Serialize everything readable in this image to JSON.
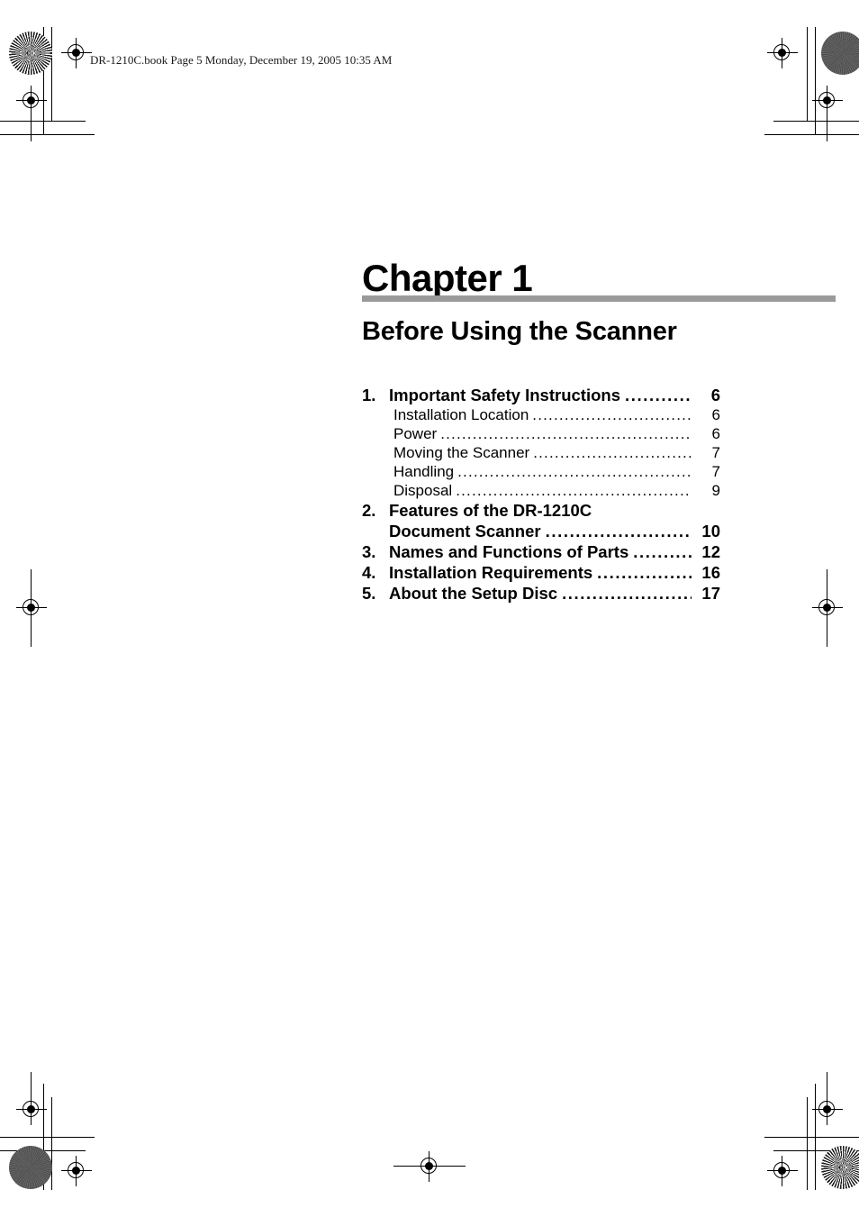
{
  "page": {
    "running_header": "DR-1210C.book  Page 5  Monday, December 19, 2005  10:35 AM",
    "chapter_label": "Chapter 1",
    "chapter_title": "Before Using the Scanner",
    "rule_color": "#9a9a9a"
  },
  "toc": {
    "entries": [
      {
        "level": "major",
        "number": "1.",
        "label": "Important Safety Instructions",
        "leader": "..............",
        "page": "6"
      },
      {
        "level": "minor",
        "number": "",
        "label": "Installation Location",
        "leader": "....................................",
        "page": "6"
      },
      {
        "level": "minor",
        "number": "",
        "label": "Power",
        "leader": "..........................................................",
        "page": "6"
      },
      {
        "level": "minor",
        "number": "",
        "label": "Moving the Scanner",
        "leader": "...................................",
        "page": "7"
      },
      {
        "level": "minor",
        "number": "",
        "label": "Handling",
        "leader": ".....................................................",
        "page": "7"
      },
      {
        "level": "minor",
        "number": "",
        "label": "Disposal",
        "leader": "......................................................",
        "page": "9"
      },
      {
        "level": "major",
        "number": "2.",
        "label": "Features of the DR-1210C",
        "leader": "",
        "page": ""
      },
      {
        "level": "major-cont",
        "number": "",
        "label": "Document Scanner",
        "leader": "............................",
        "page": "10"
      },
      {
        "level": "major",
        "number": "3.",
        "label": "Names and Functions of Parts",
        "leader": "..........",
        "page": "12"
      },
      {
        "level": "major",
        "number": "4.",
        "label": "Installation Requirements",
        "leader": "..................",
        "page": "16"
      },
      {
        "level": "major",
        "number": "5.",
        "label": "About the Setup Disc",
        "leader": "........................",
        "page": "17"
      }
    ]
  }
}
